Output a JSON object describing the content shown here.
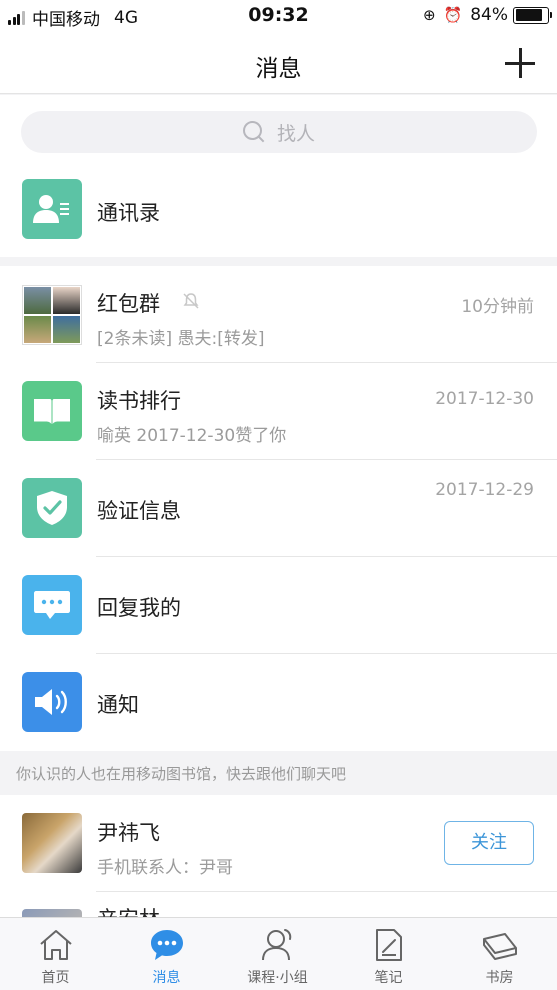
{
  "status_bar": {
    "carrier": "中国移动",
    "network": "4G",
    "time": "09:32",
    "battery": "84%",
    "battery_level": 0.84
  },
  "nav": {
    "title": "消息",
    "add_icon": "plus-icon"
  },
  "search": {
    "placeholder": "找人",
    "icon": "search-icon"
  },
  "contacts": {
    "label": "通讯录",
    "icon": "contact-book-icon",
    "icon_color": "#5cc3a5"
  },
  "conversations": [
    {
      "title": "红包群",
      "subtitle": "[2条未读] 愚夫:[转发]",
      "time": "10分钟前",
      "muted": true,
      "icon": "group-avatar"
    },
    {
      "title": "读书排行",
      "subtitle": "喻英 2017-12-30赞了你",
      "time": "2017-12-30",
      "icon": "open-book-icon",
      "icon_color": "#5ac98a"
    },
    {
      "title": "验证信息",
      "subtitle": "",
      "time": "2017-12-29",
      "icon": "shield-check-icon",
      "icon_color": "#5cc3a5"
    },
    {
      "title": "回复我的",
      "subtitle": "",
      "time": "",
      "icon": "chat-bubble-icon",
      "icon_color": "#4ab3ec"
    },
    {
      "title": "通知",
      "subtitle": "",
      "time": "",
      "icon": "speaker-icon",
      "icon_color": "#3c8fe8"
    }
  ],
  "suggest": {
    "banner": "你认识的人也在用移动图书馆，快去跟他们聊天吧",
    "people": [
      {
        "name": "尹祎飞",
        "subtitle": "手机联系人：尹哥",
        "follow_label": "关注"
      }
    ],
    "partial_name": "辛安林"
  },
  "tabs": [
    {
      "label": "首页",
      "icon": "home-icon",
      "active": false
    },
    {
      "label": "消息",
      "icon": "message-icon",
      "active": true
    },
    {
      "label": "课程·小组",
      "icon": "person-group-icon",
      "active": false
    },
    {
      "label": "笔记",
      "icon": "notes-icon",
      "active": false
    },
    {
      "label": "书房",
      "icon": "bookshelf-icon",
      "active": false
    }
  ],
  "colors": {
    "accent": "#2f8ee6",
    "follow_border": "#6fb4e6"
  }
}
